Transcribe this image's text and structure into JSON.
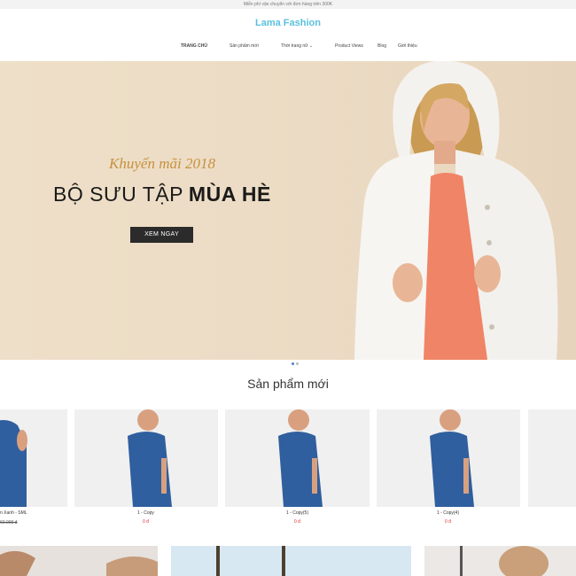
{
  "topbar": {
    "text": "Miễn phí vận chuyển với đơn hàng trên 300K"
  },
  "header": {
    "logo": "Lama Fashion"
  },
  "nav": [
    {
      "label": "TRANG CHỦ"
    },
    {
      "label": "Sản phẩm mới"
    },
    {
      "label": "Thời trang nữ ⌄"
    },
    {
      "label": "Product Views"
    },
    {
      "label": "Blog"
    },
    {
      "label": "Giới thiệu"
    }
  ],
  "hero": {
    "promo": "Khuyến mãi 2018",
    "collection_prefix": "BỘ SƯU TẬP",
    "collection_bold": "MÙA HÈ",
    "cta": "XEM NGAY"
  },
  "section": {
    "title": "Sản phẩm mới"
  },
  "products": [
    {
      "name": "n Xanh - SML",
      "old_price": "60.000 đ",
      "price": ""
    },
    {
      "name": "1 - Copy",
      "price": "0 đ"
    },
    {
      "name": "1 - Copy(5)",
      "price": "0 đ"
    },
    {
      "name": "1 - Copy(4)",
      "price": "0 đ"
    }
  ]
}
